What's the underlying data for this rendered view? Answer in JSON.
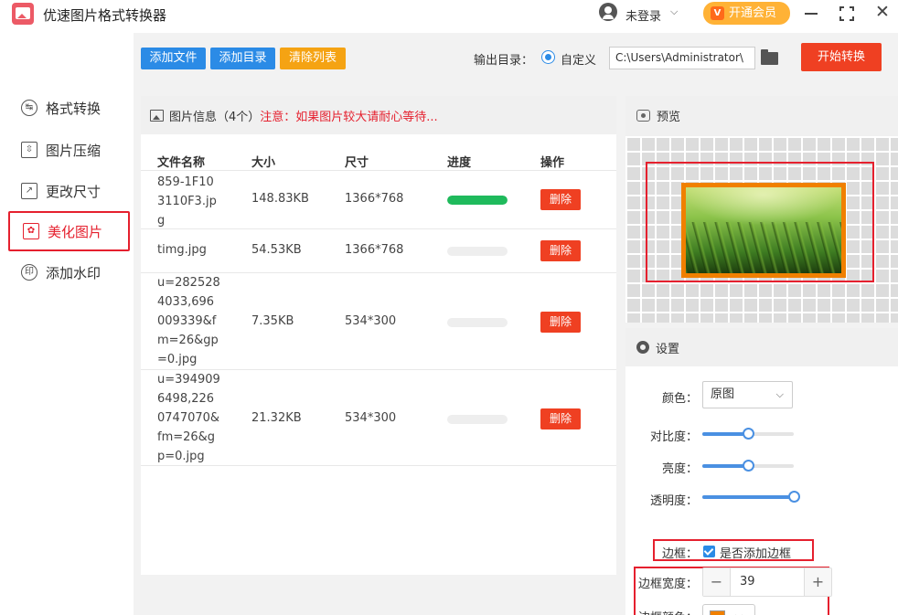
{
  "app": {
    "title": "优速图片格式转换器",
    "login_text": "未登录",
    "vip_label": "开通会员",
    "vip_badge": "V"
  },
  "sidebar": {
    "items": [
      {
        "label": "格式转换",
        "icon": "↹"
      },
      {
        "label": "图片压缩",
        "icon": "⇳"
      },
      {
        "label": "更改尺寸",
        "icon": "↗"
      },
      {
        "label": "美化图片",
        "icon": "✿"
      },
      {
        "label": "添加水印",
        "icon": "印"
      }
    ],
    "active_index": 3
  },
  "toolbar": {
    "add_file": "添加文件",
    "add_dir": "添加目录",
    "clear_list": "清除列表",
    "output_label": "输出目录：",
    "custom_label": "自定义",
    "output_path": "C:\\Users\\Administrator\\",
    "start_label": "开始转换"
  },
  "file_panel": {
    "title": "图片信息（4个）",
    "warning": "注意：如果图片较大请耐心等待...",
    "columns": [
      "文件名称",
      "大小",
      "尺寸",
      "进度",
      "操作"
    ],
    "rows": [
      {
        "name": "859-1F103110F3.jpg",
        "size": "148.83KB",
        "dims": "1366*768",
        "progress": 1.0,
        "action": "删除"
      },
      {
        "name": "timg.jpg",
        "size": "54.53KB",
        "dims": "1366*768",
        "progress": 0.0,
        "action": "删除"
      },
      {
        "name": "u=2825284033,696009339&fm=26&gp=0.jpg",
        "size": "7.35KB",
        "dims": "534*300",
        "progress": 0.0,
        "action": "删除"
      },
      {
        "name": "u=3949096498,2260747070&fm=26&gp=0.jpg",
        "size": "21.32KB",
        "dims": "534*300",
        "progress": 0.0,
        "action": "删除"
      }
    ]
  },
  "preview": {
    "title": "预览",
    "border_color": "#f08000"
  },
  "settings": {
    "title": "设置",
    "color_label": "颜色：",
    "color_value": "原图",
    "contrast_label": "对比度：",
    "contrast": 0.5,
    "brightness_label": "亮度：",
    "brightness": 0.5,
    "opacity_label": "透明度：",
    "opacity": 1.0,
    "border_label": "边框：",
    "border_check_label": "是否添加边框",
    "border_checked": true,
    "border_width_label": "边框宽度：",
    "border_width": "39",
    "minus": "−",
    "plus": "+",
    "border_color_label": "边框颜色：",
    "border_color": "#f08000"
  },
  "colors": {
    "accent_red": "#ef4022",
    "accent_blue": "#2b8be6",
    "accent_orange": "#f5a313",
    "progress_green": "#1fba5c"
  }
}
